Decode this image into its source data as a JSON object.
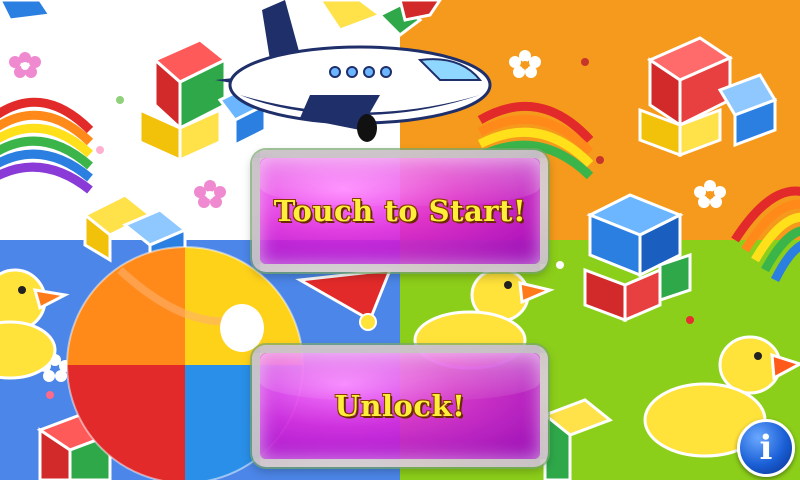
{
  "screen": {
    "start_button_label": "Touch to Start!",
    "unlock_button_label": "Unlock!",
    "info_icon_glyph": "i"
  },
  "background": {
    "quadrant_colors": [
      "#ffffff",
      "#f59a1c",
      "#4c86e8",
      "#8ccf1a"
    ],
    "toys": [
      "building-blocks",
      "rainbow-ring-stacker",
      "rubber-duck",
      "beach-ball",
      "airplane",
      "flower"
    ]
  },
  "buttons": {
    "color": "#d12ad8",
    "label_color": "#ffef3a"
  }
}
